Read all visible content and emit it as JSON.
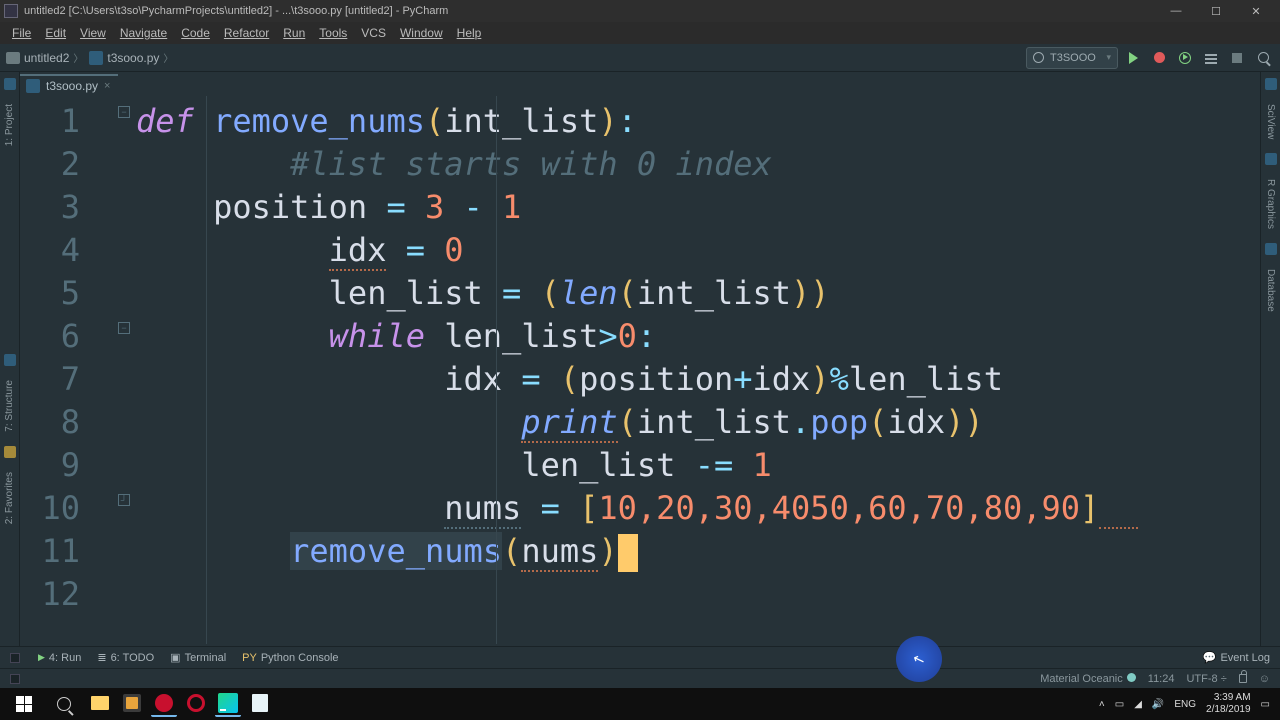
{
  "window": {
    "title": "untitled2 [C:\\Users\\t3so\\PycharmProjects\\untitled2] - ...\\t3sooo.py [untitled2] - PyCharm"
  },
  "menus": {
    "file": "File",
    "edit": "Edit",
    "view": "View",
    "navigate": "Navigate",
    "code": "Code",
    "refactor": "Refactor",
    "run": "Run",
    "tools": "Tools",
    "vcs": "VCS",
    "window": "Window",
    "help": "Help"
  },
  "breadcrumb": {
    "project": "untitled2",
    "file": "t3sooo.py"
  },
  "run_config": {
    "name": "T3SOOO"
  },
  "tabs": {
    "active": "t3sooo.py"
  },
  "code": {
    "lines": [
      "1",
      "2",
      "3",
      "4",
      "5",
      "6",
      "7",
      "8",
      "9",
      "10",
      "11",
      "12"
    ],
    "l1_def": "def",
    "l1_sp": " ",
    "l1_fn": "remove_nums",
    "l1_open": "(",
    "l1_param": "int_list",
    "l1_close": ")",
    "l1_colon": ":",
    "l2_indent": "        ",
    "l2_comment": "#list starts with 0 index",
    "l3_indent": "    ",
    "l3_ident": "position",
    "l3_eq": " = ",
    "l3_a": "3",
    "l3_minus": " - ",
    "l3_b": "1",
    "l4_indent": "          ",
    "l4_ident": "idx",
    "l4_eq": " = ",
    "l4_val": "0",
    "l5_indent": "          ",
    "l5_ident": "len_list",
    "l5_eq": " = ",
    "l5_po": "(",
    "l5_len": "len",
    "l5_io": "(",
    "l5_arg": "int_list",
    "l5_ic": ")",
    "l5_pc": ")",
    "l6_indent": "          ",
    "l6_while": "while",
    "l6_sp": " ",
    "l6_expr_id": "len_list",
    "l6_gt": ">",
    "l6_zero": "0",
    "l6_colon": ":",
    "l7_indent": "                ",
    "l7_idx": "idx",
    "l7_eq": " = ",
    "l7_po": "(",
    "l7_pos": "position",
    "l7_plus": "+",
    "l7_idx2": "idx",
    "l7_pc": ")",
    "l7_mod": "%",
    "l7_ll": "len_list",
    "l8_indent": "                    ",
    "l8_print": "print",
    "l8_po": "(",
    "l8_il": "int_list",
    "l8_dot": ".",
    "l8_pop": "pop",
    "l8_io": "(",
    "l8_idx": "idx",
    "l8_ic": ")",
    "l8_pc": ")",
    "l9_indent": "                    ",
    "l9_id": "len_list",
    "l9_op": " -= ",
    "l9_val": "1",
    "l10_indent": "                ",
    "l10_nums": "nums",
    "l10_eq": " = ",
    "l10_bo": "[",
    "l10_vals": "10,20,30,4050,60,70,80,90",
    "l10_bc": "]",
    "l11_indent": "        ",
    "l11_fn": "remove_nums",
    "l11_po": "(",
    "l11_arg": "nums",
    "l11_pc": ")"
  },
  "left_tools": {
    "project": "1: Project",
    "structure": "7: Structure",
    "favorites": "2: Favorites"
  },
  "right_tools": {
    "sciview": "SciView",
    "rgraphics": "R Graphics",
    "database": "Database"
  },
  "bottom_tools": {
    "run": "4: Run",
    "todo": "6: TODO",
    "terminal": "Terminal",
    "python_console": "Python Console",
    "event_log": "Event Log"
  },
  "status": {
    "theme": "Material Oceanic",
    "pos": "11:24",
    "encoding": "UTF-8",
    "sep_icon": "÷"
  },
  "tray": {
    "lang": "ENG",
    "time": "3:39 AM",
    "date": "2/18/2019"
  }
}
